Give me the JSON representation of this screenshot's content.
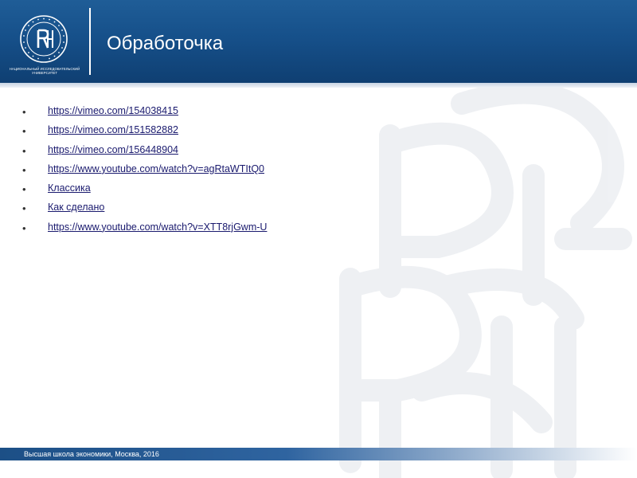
{
  "header": {
    "title": "Обработочка",
    "logo_caption": "НАЦИОНАЛЬНЫЙ ИССЛЕДОВАТЕЛЬСКИЙ УНИВЕРСИТЕТ",
    "logo_ring_text": "ВЫСШАЯ ШКОЛА ЭКОНОМИКИ"
  },
  "links": [
    {
      "label": "https://vimeo.com/154038415"
    },
    {
      "label": "https://vimeo.com/151582882"
    },
    {
      "label": "https://vimeo.com/156448904"
    },
    {
      "label": "https://www.youtube.com/watch?v=agRtaWTItQ0"
    },
    {
      "label": "Классика"
    },
    {
      "label": "Как сделано"
    },
    {
      "label": "https://www.youtube.com/watch?v=XTT8rjGwm-U"
    }
  ],
  "bullet_symbol": "•",
  "footer": {
    "text": "Высшая школа экономики, Москва, 2016"
  },
  "colors": {
    "header_blue": "#1a5490",
    "link": "#1a1a6e",
    "footer_blue": "#1c4f86"
  }
}
